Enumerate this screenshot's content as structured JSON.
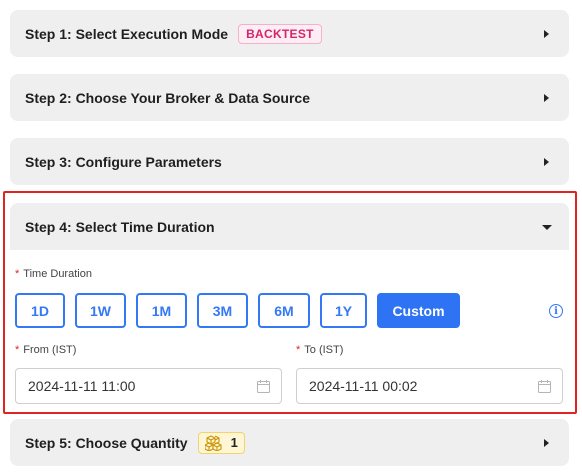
{
  "steps": {
    "step1": {
      "title": "Step 1: Select Execution Mode",
      "badge": "BACKTEST"
    },
    "step2": {
      "title": "Step 2: Choose Your Broker & Data Source"
    },
    "step3": {
      "title": "Step 3: Configure Parameters"
    },
    "step4": {
      "title": "Step 4: Select Time Duration"
    },
    "step5": {
      "title": "Step 5: Choose Quantity",
      "badge_value": "1"
    }
  },
  "duration": {
    "required_mark": "*",
    "label": "Time Duration",
    "options": [
      "1D",
      "1W",
      "1M",
      "3M",
      "6M",
      "1Y",
      "Custom"
    ],
    "selected": "Custom",
    "info_glyph": "i"
  },
  "from": {
    "label": "From (IST)",
    "value": "2024-11-11 11:00"
  },
  "to": {
    "label": "To (IST)",
    "value": "2024-11-11 00:02"
  },
  "colors": {
    "accent": "#2f73f5",
    "highlight_border": "#e02424",
    "badge_backtest": "#d6246e",
    "badge_quantity_bg": "#fff6d6"
  },
  "icons": {
    "collapsed": "caret-right-icon",
    "expanded": "caret-down-icon",
    "info": "info-icon",
    "calendar": "calendar-icon",
    "quantity": "cubes-icon"
  }
}
